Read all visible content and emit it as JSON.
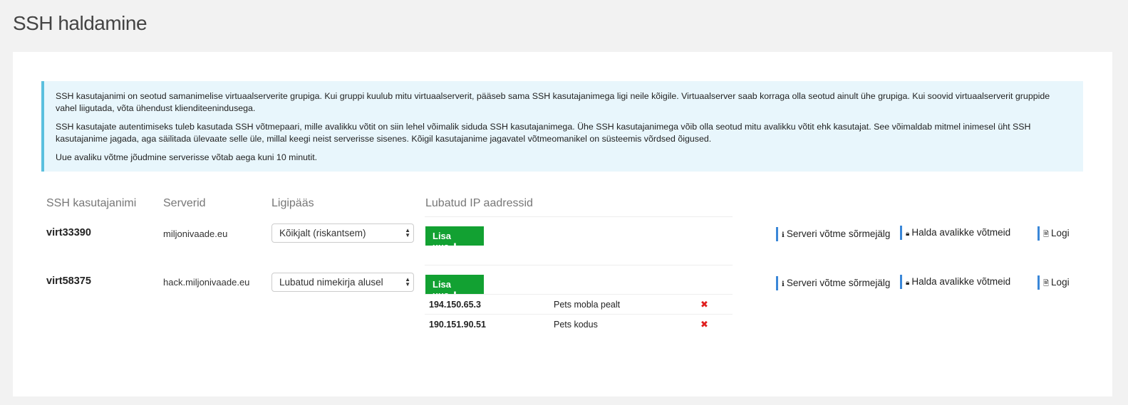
{
  "page": {
    "title": "SSH haldamine"
  },
  "info": {
    "p1": "SSH kasutajanimi on seotud samanimelise virtuaalserverite grupiga. Kui gruppi kuulub mitu virtuaalserverit, pääseb sama SSH kasutajanimega ligi neile kõigile. Virtuaalserver saab korraga olla seotud ainult ühe grupiga. Kui soovid virtuaalserverit gruppide vahel liigutada, võta ühendust klienditeenindusega.",
    "p2": "SSH kasutajate autentimiseks tuleb kasutada SSH võtmepaari, mille avalikku võtit on siin lehel võimalik siduda SSH kasutajanimega. Ühe SSH kasutajanimega võib olla seotud mitu avalikku võtit ehk kasutajat. See võimaldab mitmel inimesel üht SSH kasutajanime jagada, aga säilitada ülevaate selle üle, millal keegi neist serverisse sisenes. Kõigil kasutajanime jagavatel võtmeomanikel on süsteemis võrdsed õigused.",
    "p3": "Uue avaliku võtme jõudmine serverisse võtab aega kuni 10 minutit."
  },
  "table": {
    "headers": {
      "username": "SSH kasutajanimi",
      "servers": "Serverid",
      "access": "Ligipääs",
      "ips": "Lubatud IP aadressid"
    },
    "rows": [
      {
        "username": "virt33390",
        "server": "miljonivaade.eu",
        "access": "Kõikjalt (riskantsem)",
        "add_label": "Lisa uus",
        "ips": [],
        "actions": {
          "fingerprint": "Serveri võtme sõrmejälg",
          "keys": "Halda avalikke võtmeid",
          "log": "Logi"
        }
      },
      {
        "username": "virt58375",
        "server": "hack.miljonivaade.eu",
        "access": "Lubatud nimekirja alusel",
        "add_label": "Lisa uus",
        "ips": [
          {
            "address": "194.150.65.3",
            "description": "Pets mobla pealt"
          },
          {
            "address": "190.151.90.51",
            "description": "Pets kodus"
          }
        ],
        "actions": {
          "fingerprint": "Serveri võtme sõrmejälg",
          "keys": "Halda avalikke võtmeid",
          "log": "Logi"
        }
      }
    ]
  },
  "icons": {
    "info": "info-icon",
    "lock": "lock-icon",
    "file": "file-icon",
    "plus": "plus-icon",
    "remove": "remove-icon",
    "select_arrows": "select-arrows-icon"
  },
  "colors": {
    "add_button": "#12a132",
    "info_border": "#5bc0de",
    "info_bg": "#e8f6fc",
    "action_border": "#3a87d8",
    "remove": "#e02020"
  }
}
